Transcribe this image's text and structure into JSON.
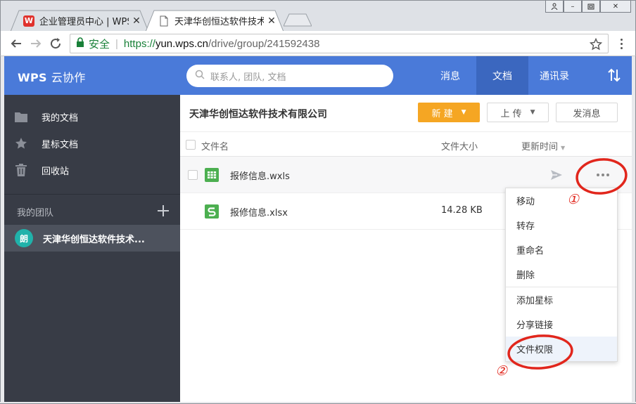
{
  "browser": {
    "tabs": [
      {
        "title": "企业管理员中心 | WPS+",
        "favicon": "wps-icon",
        "favicon_text": "W"
      },
      {
        "title": "天津华创恒达软件技术有",
        "favicon": "document-icon"
      }
    ],
    "secure_label": "安全",
    "url_scheme": "https://",
    "url_host": "yun.wps.cn",
    "url_path": "/drive/group/241592438"
  },
  "header": {
    "brand": "WPS",
    "brand_sub": "云协作",
    "search_placeholder": "联系人, 团队, 文档",
    "nav": [
      "消息",
      "文档",
      "通讯录"
    ],
    "active_nav": "文档",
    "accent_color": "#4a7ad9"
  },
  "sidebar": {
    "items": [
      {
        "label": "我的文档",
        "icon": "folder-icon"
      },
      {
        "label": "星标文档",
        "icon": "star-icon"
      },
      {
        "label": "回收站",
        "icon": "trash-icon"
      }
    ],
    "team_section_label": "我的团队",
    "team": {
      "avatar_text": "朗",
      "label": "天津华创恒达软件技术..."
    }
  },
  "main": {
    "title": "天津华创恒达软件技术有限公司",
    "new_button": "新 建",
    "upload_button": "上 传",
    "message_button": "发消息",
    "columns": {
      "name": "文件名",
      "size": "文件大小",
      "updated": "更新时间"
    },
    "files": [
      {
        "name": "报修信息.wxls",
        "size": "",
        "icon": "spreadsheet-grid-icon",
        "icon_color": "#4caf50"
      },
      {
        "name": "报修信息.xlsx",
        "size": "14.28 KB",
        "icon": "spreadsheet-s-icon",
        "icon_color": "#4caf50"
      }
    ]
  },
  "context_menu": {
    "items": [
      "移动",
      "转存",
      "重命名",
      "删除",
      "添加星标",
      "分享链接",
      "文件权限"
    ],
    "highlighted": "文件权限"
  },
  "annotations": {
    "marker_1": "①",
    "marker_2": "②",
    "color": "#e1261c"
  }
}
